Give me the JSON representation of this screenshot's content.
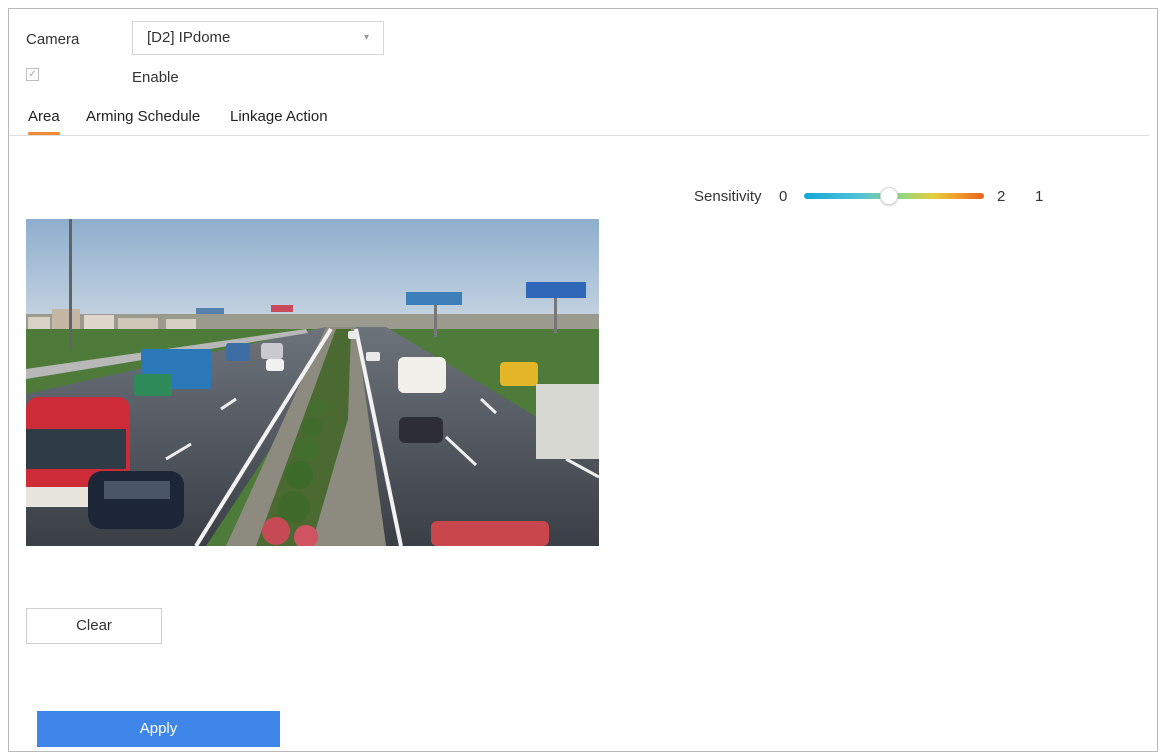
{
  "camera": {
    "label": "Camera",
    "selected": "[D2] IPdome"
  },
  "enable": {
    "label": "Enable",
    "checked": true
  },
  "tabs": [
    {
      "label": "Area",
      "active": true
    },
    {
      "label": "Arming Schedule",
      "active": false
    },
    {
      "label": "Linkage Action",
      "active": false
    }
  ],
  "sensitivity": {
    "label": "Sensitivity",
    "min_label": "0",
    "value_label": "2",
    "extra_label": "1",
    "level_fraction": 0.45
  },
  "buttons": {
    "clear": "Clear",
    "apply": "Apply"
  },
  "colors": {
    "accent_tab": "#f08a35",
    "apply_button": "#3f86ea"
  }
}
